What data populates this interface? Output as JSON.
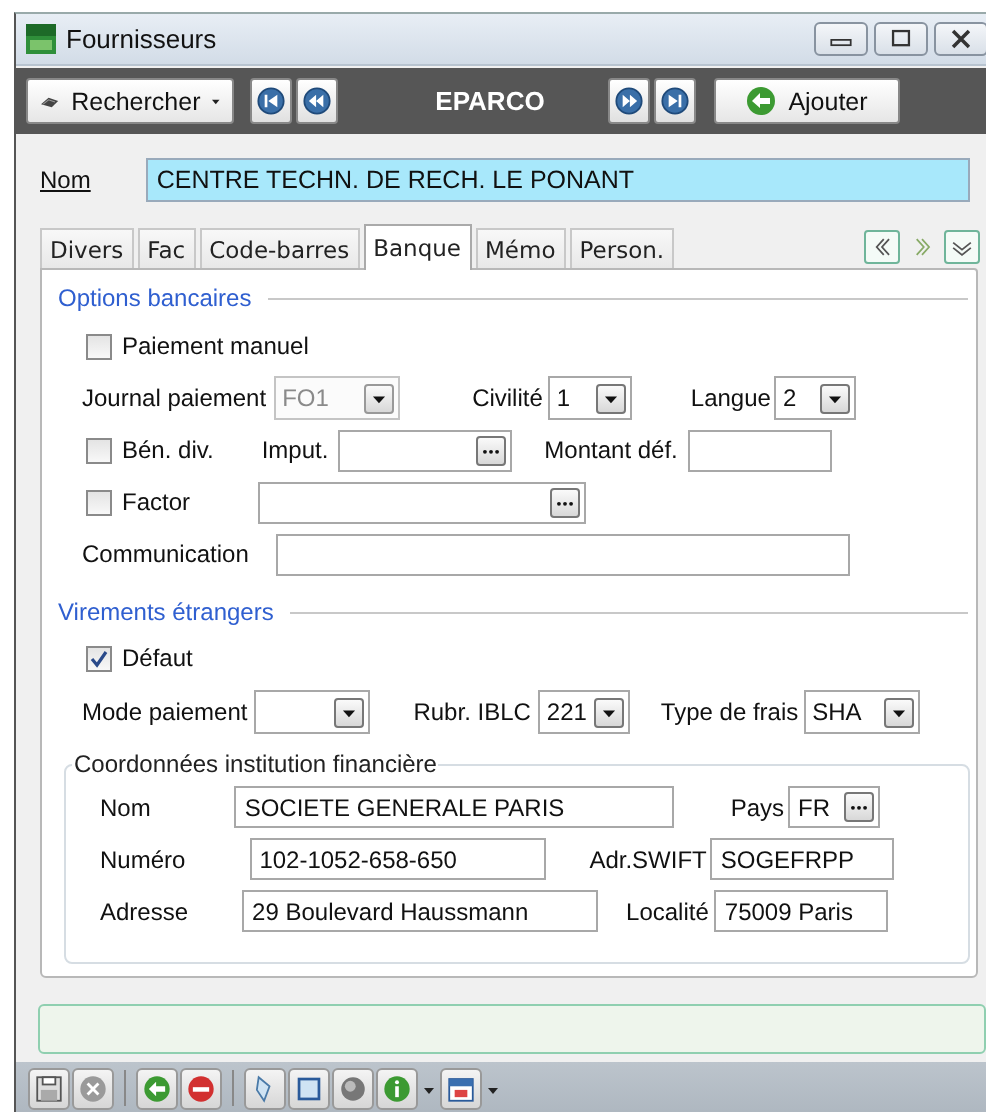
{
  "window": {
    "title": "Fournisseurs"
  },
  "toolbar": {
    "search_button": "Rechercher",
    "record": "EPARCO",
    "add_button": "Ajouter"
  },
  "name_field": {
    "label": "Nom",
    "value": "CENTRE TECHN. DE RECH. LE PONANT"
  },
  "tabs": [
    {
      "label": "Divers",
      "selected": false
    },
    {
      "label": "Fac",
      "selected": false
    },
    {
      "label": "Code-barres",
      "selected": false
    },
    {
      "label": "Banque",
      "selected": true
    },
    {
      "label": "Mémo",
      "selected": false
    },
    {
      "label": "Person.",
      "selected": false
    }
  ],
  "bank_options": {
    "title": "Options bancaires",
    "manual_payment": {
      "label": "Paiement manuel",
      "checked": false
    },
    "payment_journal": {
      "label": "Journal paiement",
      "value": "FO1",
      "disabled": true
    },
    "civility": {
      "label": "Civilité",
      "value": "1",
      "disabled": false
    },
    "language": {
      "label": "Langue",
      "value": "2",
      "disabled": false
    },
    "beneficiary": {
      "label": "Bén. div.",
      "checked": false
    },
    "imputation": {
      "label": "Imput."
    },
    "default_amount": {
      "label": "Montant déf."
    },
    "factor": {
      "label": "Factor",
      "checked": false
    },
    "communication": {
      "label": "Communication"
    }
  },
  "foreign_transfers": {
    "title": "Virements étrangers",
    "default": {
      "label": "Défaut",
      "checked": true
    },
    "payment_mode": {
      "label": "Mode paiement",
      "disabled": false
    },
    "iblc": {
      "label": "Rubr. IBLC",
      "value": "221",
      "disabled": false
    },
    "fee_type": {
      "label": "Type de frais",
      "value": "SHA",
      "disabled": false
    },
    "institution": {
      "title": "Coordonnées institution financière",
      "name": {
        "label": "Nom",
        "value": "SOCIETE GENERALE PARIS"
      },
      "country": {
        "label": "Pays",
        "value": "FR"
      },
      "number": {
        "label": "Numéro",
        "value": "102-1052-658-650"
      },
      "swift": {
        "label": "Adr.SWIFT",
        "value": "SOGEFRPP"
      },
      "address": {
        "label": "Adresse",
        "value": "29 Boulevard Haussmann"
      },
      "city": {
        "label": "Localité",
        "value": "75009 Paris"
      }
    }
  }
}
